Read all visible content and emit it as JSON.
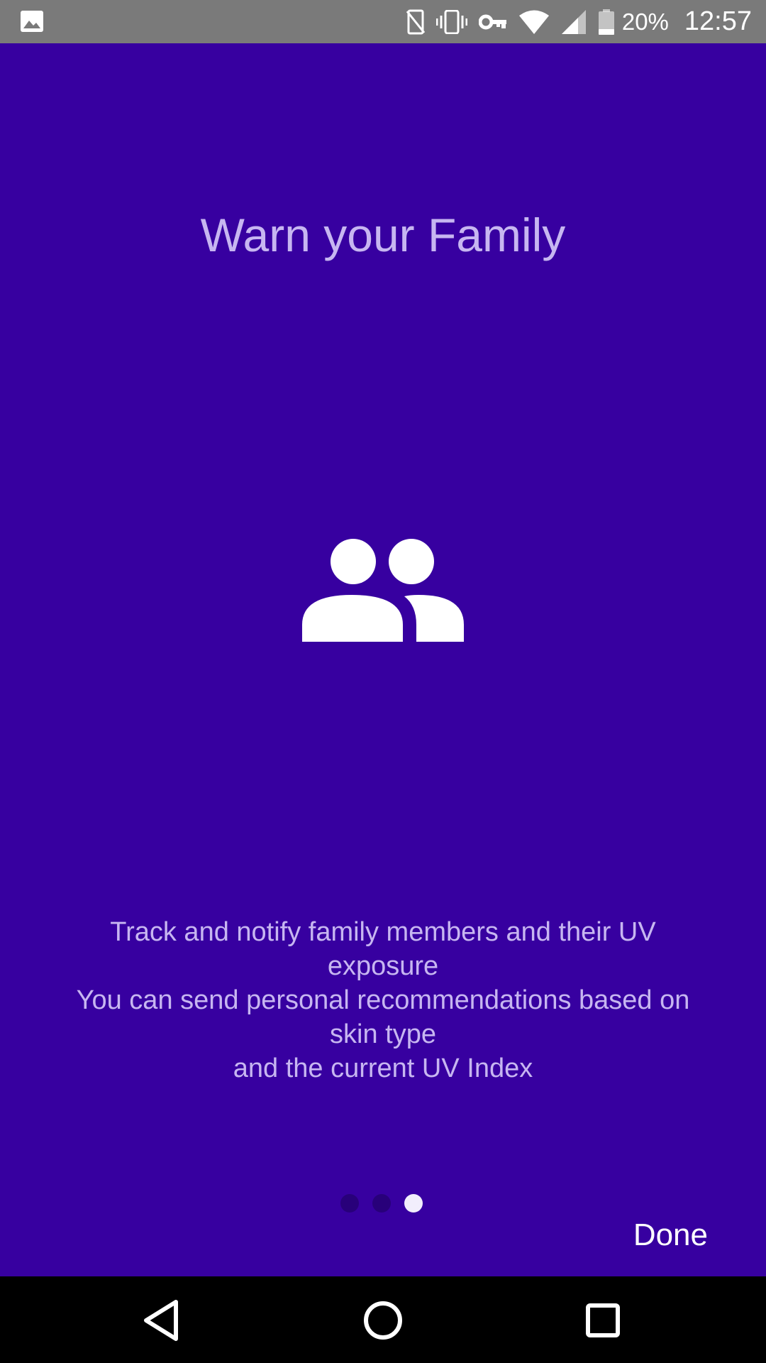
{
  "status_bar": {
    "battery_percent": "20%",
    "time": "12:57",
    "icons": [
      "image-icon",
      "nfc-icon",
      "vibrate-icon",
      "vpn-key-icon",
      "wifi-icon",
      "signal-icon",
      "battery-icon"
    ]
  },
  "onboarding": {
    "title": "Warn your Family",
    "hero_icon": "people-icon",
    "description_lines": [
      "Track and notify family members and their UV",
      "exposure",
      "You can send personal recommendations based on",
      "skin type",
      "and the current UV Index"
    ],
    "page_indicator": {
      "total": 3,
      "current": 3
    },
    "done_label": "Done"
  },
  "nav_bar": {
    "icons": [
      "back-icon",
      "home-icon",
      "recents-icon"
    ]
  },
  "colors": {
    "background": "#3700a0",
    "text": "#c7b6f1",
    "status_bar": "#7a7a7a",
    "dot_inactive": "#28007a",
    "dot_active": "#f2eefc"
  }
}
